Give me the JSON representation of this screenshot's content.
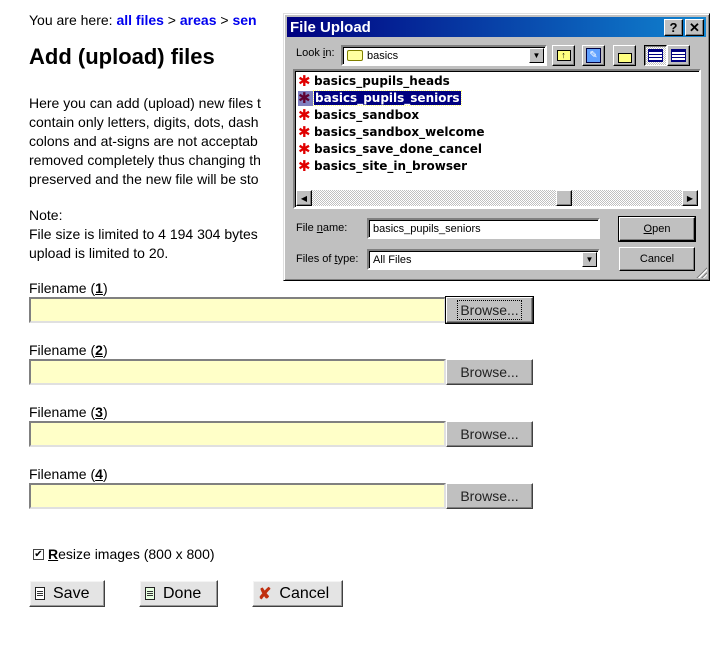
{
  "breadcrumb": {
    "prefix": "You are here: ",
    "items": [
      "all files",
      "areas",
      "sen"
    ],
    "separator": " > "
  },
  "page": {
    "title": "Add (upload) files",
    "intro_lines": [
      "Here you can add (upload) new files t",
      "contain only letters, digits, dots, dash",
      "colons and at-signs are not acceptab",
      "removed completely thus changing th",
      "preserved and the new file will be sto"
    ],
    "note_lines": [
      "Note:",
      "File size is limited to 4 194 304 bytes",
      "upload is limited to 20."
    ]
  },
  "fields": [
    {
      "label": "Filename (",
      "number": "1",
      "label_end": ")",
      "value": "",
      "browse_label": "Browse..."
    },
    {
      "label": "Filename (",
      "number": "2",
      "label_end": ")",
      "value": "",
      "browse_label": "Browse..."
    },
    {
      "label": "Filename (",
      "number": "3",
      "label_end": ")",
      "value": "",
      "browse_label": "Browse..."
    },
    {
      "label": "Filename (",
      "number": "4",
      "label_end": ")",
      "value": "",
      "browse_label": "Browse..."
    }
  ],
  "resize": {
    "checked": true,
    "check_glyph": "✔",
    "accel": "R",
    "label_rest": "esize images (800 x 800)"
  },
  "actions": {
    "save_label": "Save",
    "done_label": "Done",
    "cancel_label": "Cancel",
    "cancel_glyph": "✘"
  },
  "dialog": {
    "title": "File Upload",
    "help_glyph": "?",
    "close_glyph": "✕",
    "lookin_label_pre": "Look ",
    "lookin_label_accel": "i",
    "lookin_label_post": "n:",
    "lookin_value": "basics",
    "dropdown_glyph": "▼",
    "up_glyph": "↑",
    "fav_glyph": "✎",
    "files": [
      {
        "name": "basics_pupils_heads",
        "selected": false
      },
      {
        "name": "basics_pupils_seniors",
        "selected": true
      },
      {
        "name": "basics_sandbox",
        "selected": false
      },
      {
        "name": "basics_sandbox_welcome",
        "selected": false
      },
      {
        "name": "basics_save_done_cancel",
        "selected": false
      },
      {
        "name": "basics_site_in_browser",
        "selected": false
      }
    ],
    "scroll_left_glyph": "◀",
    "scroll_right_glyph": "▶",
    "filename_label_pre": "File ",
    "filename_label_accel": "n",
    "filename_label_post": "ame:",
    "filename_value": "basics_pupils_seniors",
    "filetype_label_pre": "Files of ",
    "filetype_label_accel": "t",
    "filetype_label_post": "ype:",
    "filetype_value": "All Files",
    "open_accel": "O",
    "open_rest": "pen",
    "cancel_label": "Cancel"
  }
}
